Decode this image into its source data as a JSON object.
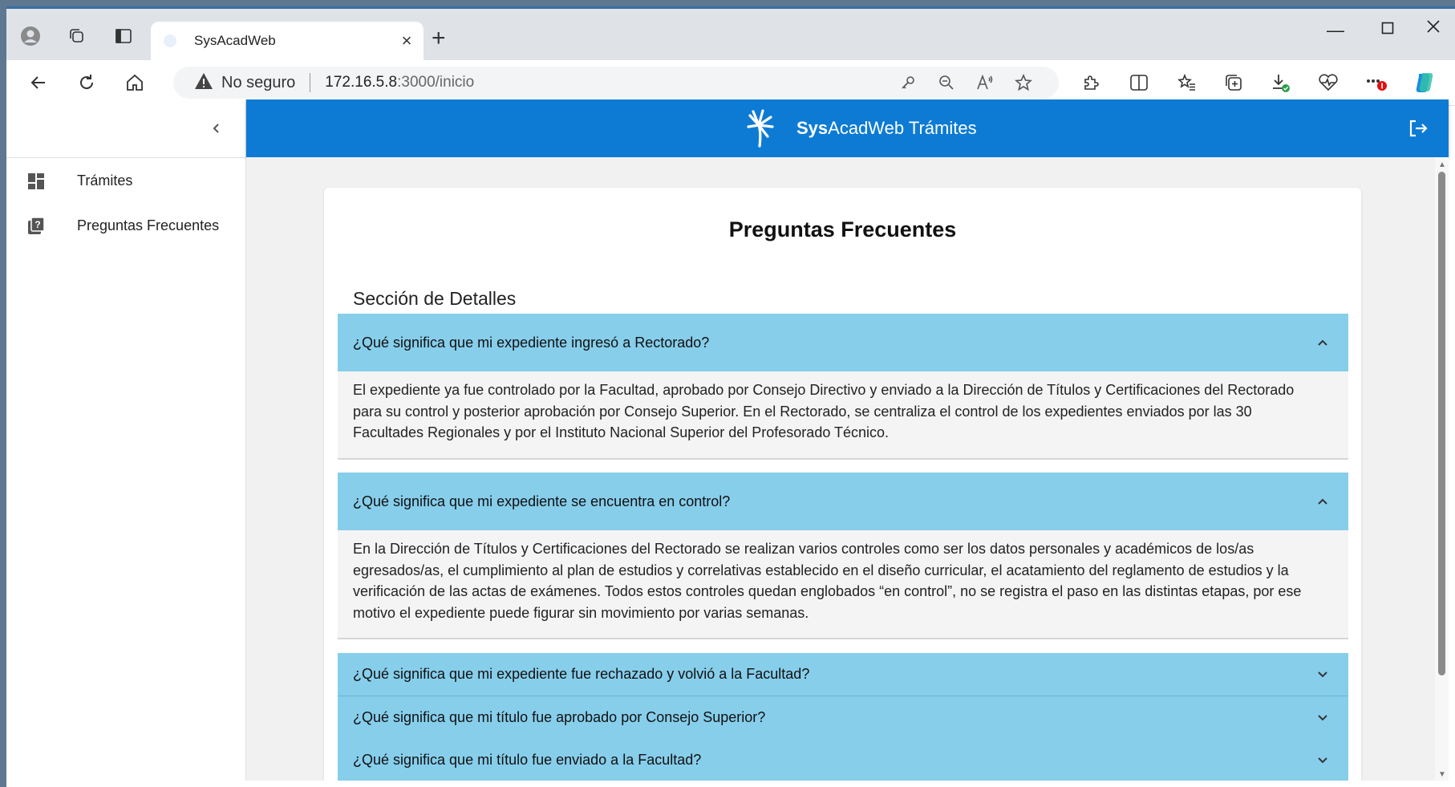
{
  "browser": {
    "tab_title": "SysAcadWeb",
    "security_label": "No seguro",
    "url_host": "172.16.5.8",
    "url_rest": ":3000/inicio"
  },
  "app": {
    "brand_bold": "Sys",
    "brand_rest": "AcadWeb Trámites",
    "accent_color": "#0d7bd4",
    "faq_header_color": "#87ceeb"
  },
  "sidebar": {
    "items": [
      {
        "label": "Trámites",
        "icon": "dashboard-icon"
      },
      {
        "label": "Preguntas Frecuentes",
        "icon": "help-book-icon"
      }
    ]
  },
  "page": {
    "title": "Preguntas Frecuentes",
    "section_title": "Sección de Detalles",
    "faqs": [
      {
        "question": "¿Qué significa que mi expediente ingresó a Rectorado?",
        "answer": "El expediente ya fue controlado por la Facultad, aprobado por Consejo Directivo y enviado a la Dirección de Títulos y Certificaciones del Rectorado para su control y posterior aprobación por Consejo Superior. En el Rectorado, se centraliza el control de los expedientes enviados por las 30 Facultades Regionales y por el Instituto Nacional Superior del Profesorado Técnico.",
        "expanded": true
      },
      {
        "question": "¿Qué significa que mi expediente se encuentra en control?",
        "answer": "En la Dirección de Títulos y Certificaciones del Rectorado se realizan varios controles como ser los datos personales y académicos de los/as egresados/as, el cumplimiento al plan de estudios y correlativas establecido en el diseño curricular, el acatamiento del reglamento de estudios y la verificación de las actas de exámenes. Todos estos controles quedan englobados “en control”, no se registra el paso en las distintas etapas, por ese motivo el expediente puede figurar sin movimiento por varias semanas.",
        "expanded": true
      },
      {
        "question": "¿Qué significa que mi expediente fue rechazado y volvió a la Facultad?",
        "expanded": false
      },
      {
        "question": "¿Qué significa que mi título fue aprobado por Consejo Superior?",
        "expanded": false
      },
      {
        "question": "¿Qué significa que mi título fue enviado a la Facultad?",
        "expanded": false
      }
    ]
  }
}
